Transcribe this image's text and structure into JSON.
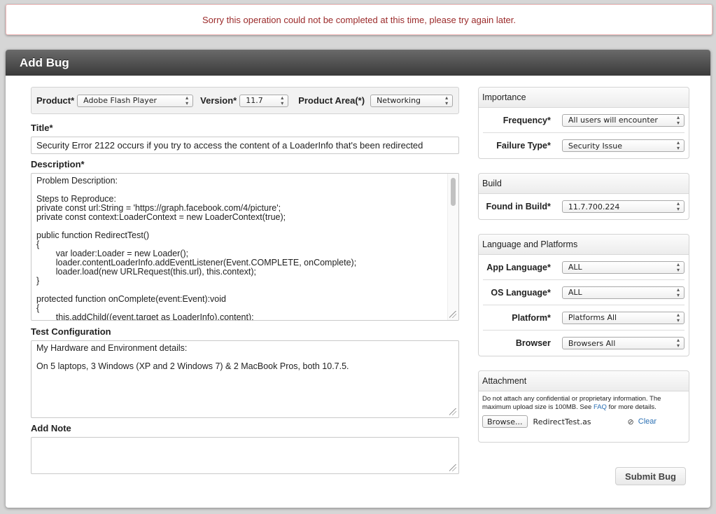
{
  "alert": {
    "message": "Sorry this operation could not be completed at this time, please try again later."
  },
  "header": {
    "title": "Add Bug"
  },
  "product_bar": {
    "product_label": "Product*",
    "product_value": "Adobe Flash Player",
    "version_label": "Version*",
    "version_value": "11.7",
    "area_label": "Product Area(*)",
    "area_value": "Networking"
  },
  "title_field": {
    "label": "Title*",
    "value": "Security Error 2122 occurs if you try to access the content of a LoaderInfo that's been redirected"
  },
  "description": {
    "label": "Description*",
    "lines": [
      "Problem Description:",
      "",
      "Steps to Reproduce:",
      "private const url:String = 'https://graph.facebook.com/4/picture';",
      "private const context:LoaderContext = new LoaderContext(true);",
      "",
      "public function RedirectTest()",
      "{",
      "        var loader:Loader = new Loader();",
      "        loader.contentLoaderInfo.addEventListener(Event.COMPLETE, onComplete);",
      "        loader.load(new URLRequest(this.url), this.context);",
      "}",
      "",
      "protected function onComplete(event:Event):void",
      "{",
      "        this.addChild((event.target as LoaderInfo).content);"
    ]
  },
  "test_config": {
    "label": "Test Configuration",
    "lines": [
      "My Hardware and Environment details:",
      "",
      "On 5 laptops, 3 Windows (XP and 2 Windows 7) & 2 MacBook Pros, both 10.7.5."
    ]
  },
  "add_note": {
    "label": "Add Note",
    "value": ""
  },
  "importance": {
    "title": "Importance",
    "rows": [
      {
        "label": "Frequency*",
        "value": "All users will encounter"
      },
      {
        "label": "Failure Type*",
        "value": "Security Issue"
      }
    ]
  },
  "build": {
    "title": "Build",
    "rows": [
      {
        "label": "Found in Build*",
        "value": "11.7.700.224"
      }
    ]
  },
  "lang_platforms": {
    "title": "Language and Platforms",
    "rows": [
      {
        "label": "App Language*",
        "value": "ALL"
      },
      {
        "label": "OS Language*",
        "value": "ALL"
      },
      {
        "label": "Platform*",
        "value": "Platforms All"
      },
      {
        "label": "Browser",
        "value": "Browsers All"
      }
    ]
  },
  "attachment": {
    "title": "Attachment",
    "note_before": "Do not attach any confidential or proprietary information. The maximum upload size is 100MB. See ",
    "faq_link": "FAQ",
    "note_after": " for more details.",
    "browse_label": "Browse...",
    "filename": "RedirectTest.as",
    "clear_label": "Clear"
  },
  "submit_label": "Submit Bug"
}
